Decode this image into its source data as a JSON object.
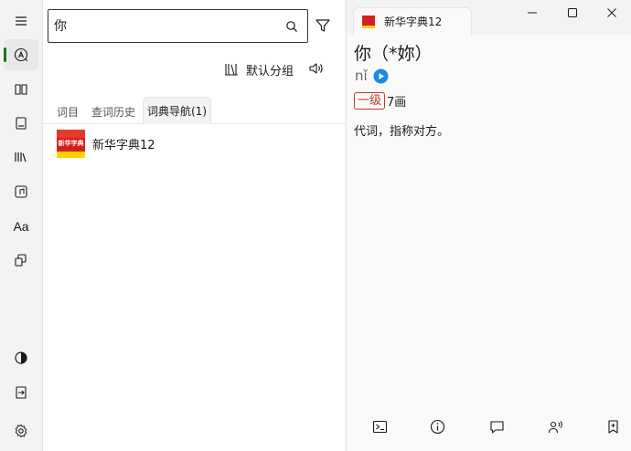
{
  "search": {
    "value": "你",
    "placeholder": ""
  },
  "toolbar": {
    "group_label": "默认分组"
  },
  "tabs": [
    {
      "label": "词目"
    },
    {
      "label": "查词历史"
    },
    {
      "label": "词典导航(1)",
      "active": true
    }
  ],
  "dictionaries": [
    {
      "name": "新华字典12",
      "logo_text": "新华字典"
    }
  ],
  "entry": {
    "tab_label": "新华字典12",
    "headword": "你（*妳）",
    "pinyin": "nǐ",
    "level": "一级",
    "strokes": "7画",
    "definition": "代词，指称对方。"
  },
  "colors": {
    "accent": "#0f7b0f",
    "level": "#c0392b",
    "play": "#1e88e5"
  }
}
